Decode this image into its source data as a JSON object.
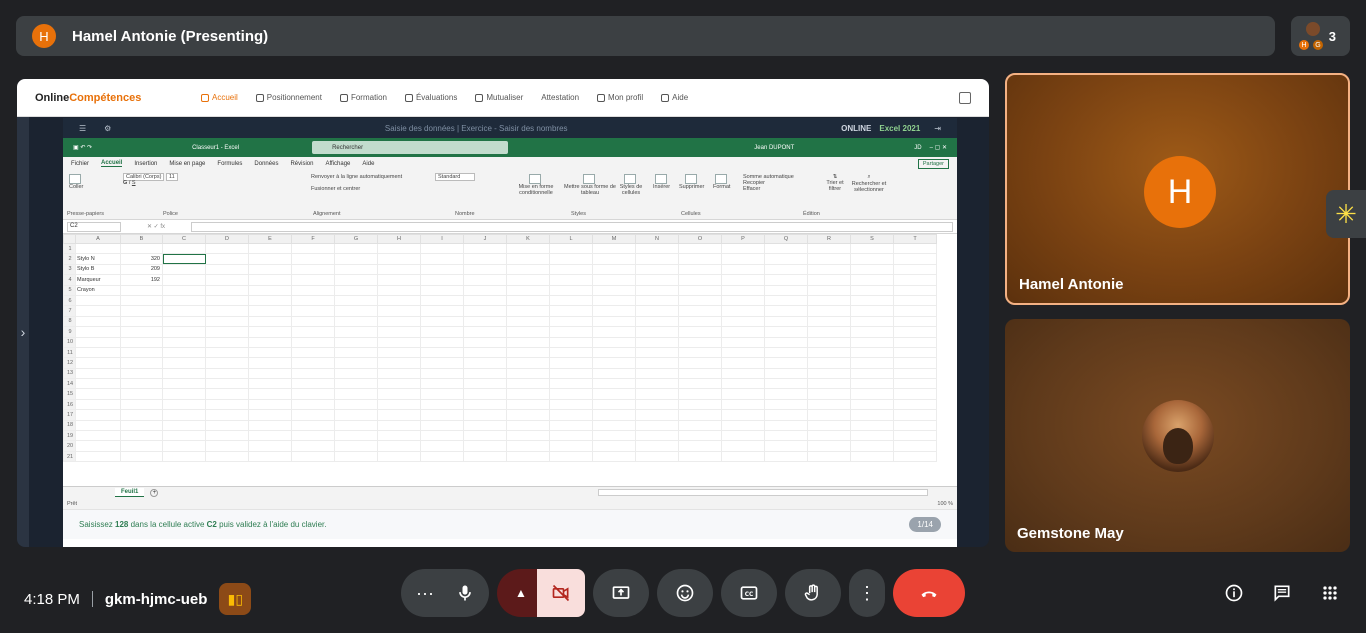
{
  "topbar": {
    "avatar_letter": "H",
    "title": "Hamel Antonie (Presenting)",
    "people_count": "3",
    "mini_avatar_letters": [
      "H",
      "G"
    ]
  },
  "presentation": {
    "site": {
      "logo_prefix": "Online",
      "logo_suffix": "Compétences",
      "nav": [
        "Accueil",
        "Positionnement",
        "Formation",
        "Évaluations",
        "Mutualiser",
        "Attestation",
        "Mon profil",
        "Aide"
      ]
    },
    "excel": {
      "top_title": "Saisie des données | Exercice - Saisir des nombres",
      "online_label": "ONLINE",
      "brand": "Excel 2021",
      "file_name": "Classeur1 - Excel",
      "search_placeholder": "Rechercher",
      "user": "Jean DUPONT",
      "user_initials": "JD",
      "tabs": [
        "Fichier",
        "Accueil",
        "Insertion",
        "Mise en page",
        "Formules",
        "Données",
        "Révision",
        "Affichage",
        "Aide"
      ],
      "share_label": "Partager",
      "ribbon": {
        "paste": "Coller",
        "clipboard": "Presse-papiers",
        "font_name": "Calibri (Corps)",
        "font_size": "11",
        "font_group": "Police",
        "wrap": "Renvoyer à la ligne automatiquement",
        "merge": "Fusionner et centrer",
        "align_group": "Alignement",
        "number_format": "Standard",
        "number_group": "Nombre",
        "cond_format": "Mise en forme conditionnelle",
        "table_format": "Mettre sous forme de tableau",
        "cell_styles": "Styles de cellules",
        "styles_group": "Styles",
        "insert": "Insérer",
        "delete": "Supprimer",
        "format": "Format",
        "cells_group": "Cellules",
        "autosum": "Somme automatique",
        "fill": "Recopier",
        "clear": "Effacer",
        "sort": "Trier et filtrer",
        "find": "Rechercher et sélectionner",
        "edit_group": "Édition"
      },
      "name_box": "C2",
      "columns": [
        "A",
        "B",
        "C",
        "D",
        "E",
        "F",
        "G",
        "H",
        "I",
        "J",
        "K",
        "L",
        "M",
        "N",
        "O",
        "P",
        "Q",
        "R",
        "S",
        "T"
      ],
      "rows": [
        {
          "n": "1",
          "a": "",
          "b": ""
        },
        {
          "n": "2",
          "a": "Stylo N",
          "b": "320"
        },
        {
          "n": "3",
          "a": "Stylo B",
          "b": "209"
        },
        {
          "n": "4",
          "a": "Marqueur",
          "b": "192"
        },
        {
          "n": "5",
          "a": "Crayon",
          "b": ""
        },
        {
          "n": "6",
          "a": "",
          "b": ""
        },
        {
          "n": "7",
          "a": "",
          "b": ""
        },
        {
          "n": "8",
          "a": "",
          "b": ""
        },
        {
          "n": "9",
          "a": "",
          "b": ""
        },
        {
          "n": "10",
          "a": "",
          "b": ""
        },
        {
          "n": "11",
          "a": "",
          "b": ""
        },
        {
          "n": "12",
          "a": "",
          "b": ""
        },
        {
          "n": "13",
          "a": "",
          "b": ""
        },
        {
          "n": "14",
          "a": "",
          "b": ""
        },
        {
          "n": "15",
          "a": "",
          "b": ""
        },
        {
          "n": "16",
          "a": "",
          "b": ""
        },
        {
          "n": "17",
          "a": "",
          "b": ""
        },
        {
          "n": "18",
          "a": "",
          "b": ""
        },
        {
          "n": "19",
          "a": "",
          "b": ""
        },
        {
          "n": "20",
          "a": "",
          "b": ""
        },
        {
          "n": "21",
          "a": "",
          "b": ""
        }
      ],
      "sheet_tab": "Feuil1",
      "status_ready": "Prêt",
      "zoom": "100 %",
      "instruction_pre": "Saisissez ",
      "instruction_val": "128",
      "instruction_mid": " dans la cellule active ",
      "instruction_cell": "C2",
      "instruction_post": " puis validez à l'aide du clavier.",
      "page_counter": "1/14"
    }
  },
  "tiles": [
    {
      "name": "Hamel Antonie",
      "letter": "H"
    },
    {
      "name": "Gemstone May"
    }
  ],
  "bottom": {
    "time": "4:18 PM",
    "meeting_code": "gkm-hjmc-ueb"
  },
  "colors": {
    "accent_orange": "#e8710a",
    "end_call": "#ea4335",
    "excel_green": "#217346"
  }
}
